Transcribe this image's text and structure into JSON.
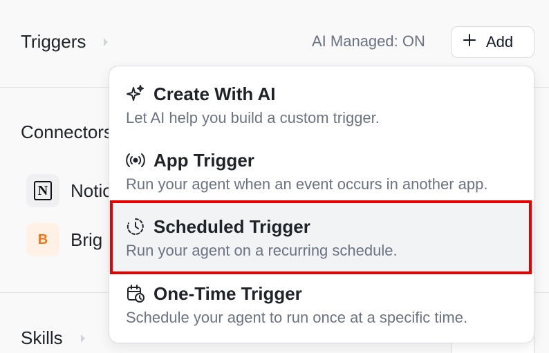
{
  "sections": {
    "triggers": "Triggers",
    "connectors": "Connectors",
    "skills": "Skills"
  },
  "ai_managed": "AI Managed: ON",
  "add_button": "Add",
  "connectors": [
    {
      "name": "Notion",
      "icon": "notion-logo"
    },
    {
      "name": "Brig",
      "icon": "b-logo",
      "badge": "B",
      "badge_color": "#f97316"
    }
  ],
  "menu": {
    "items": [
      {
        "icon": "sparkles-icon",
        "title": "Create With AI",
        "description": "Let AI help you build a custom trigger."
      },
      {
        "icon": "broadcast-icon",
        "title": "App Trigger",
        "description": "Run your agent when an event occurs in another app."
      },
      {
        "icon": "clock-icon",
        "title": "Scheduled Trigger",
        "description": "Run your agent on a recurring schedule.",
        "highlighted": true
      },
      {
        "icon": "calendar-clock-icon",
        "title": "One-Time Trigger",
        "description": "Schedule your agent to run once at a specific time."
      }
    ]
  },
  "colors": {
    "highlight_border": "#e60000",
    "muted_text": "#6b7280",
    "brand_b": "#f97316"
  }
}
